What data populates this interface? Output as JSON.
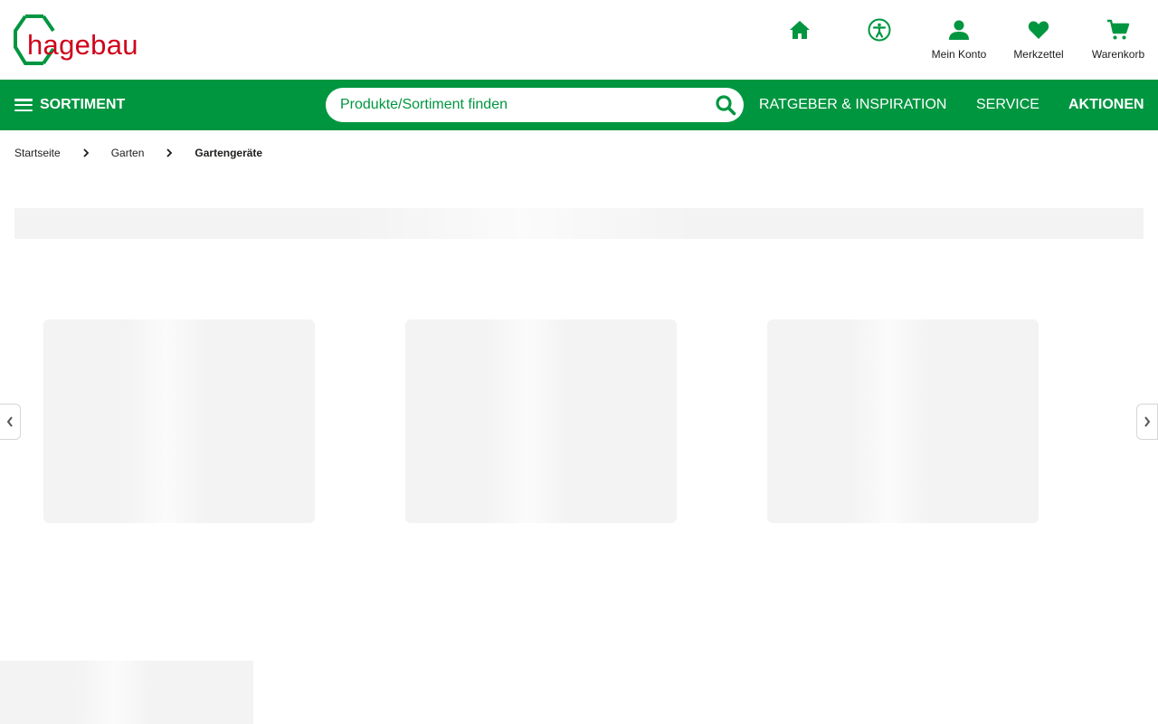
{
  "brand": {
    "logo_text": "hagebau",
    "primary_color": "#009640",
    "logo_color": "#d0021b"
  },
  "header": {
    "icons": [
      {
        "name": "home-icon",
        "label": ""
      },
      {
        "name": "accessibility-icon",
        "label": ""
      },
      {
        "name": "user-icon",
        "label": "Mein Konto"
      },
      {
        "name": "heart-icon",
        "label": "Merkzettel"
      },
      {
        "name": "cart-icon",
        "label": "Warenkorb"
      }
    ]
  },
  "nav": {
    "sortiment_label": "SORTIMENT",
    "search_placeholder": "Produkte/Sortiment finden",
    "links": [
      {
        "label": "RATGEBER & INSPIRATION",
        "bold": false
      },
      {
        "label": "SERVICE",
        "bold": false
      },
      {
        "label": "AKTIONEN",
        "bold": true
      }
    ]
  },
  "breadcrumb": {
    "items": [
      "Startseite",
      "Garten",
      "Gartengeräte"
    ]
  }
}
